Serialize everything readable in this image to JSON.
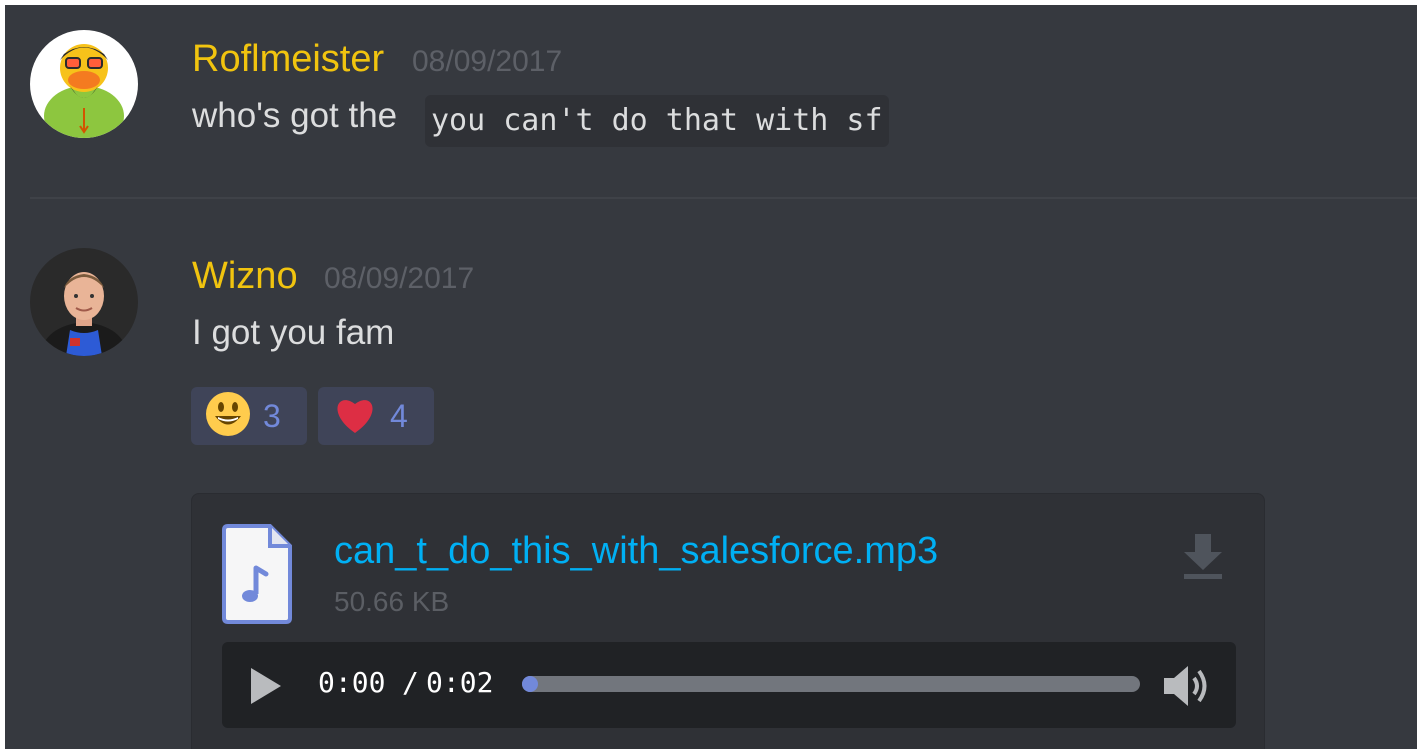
{
  "messages": [
    {
      "username": "Roflmeister",
      "timestamp": "08/09/2017",
      "text": "who's got the",
      "code": "you can't do that with sf",
      "avatar_icon": "rubber-duck-avatar",
      "name_color": "#f1c40f"
    },
    {
      "username": "Wizno",
      "timestamp": "08/09/2017",
      "text": "I got you fam",
      "avatar_icon": "person-photo-avatar",
      "name_color": "#f1c40f",
      "reactions": [
        {
          "emoji": "smiley-face",
          "count": "3"
        },
        {
          "emoji": "red-heart",
          "count": "4"
        }
      ],
      "attachment": {
        "file_name": "can_t_do_this_with_salesforce.mp3",
        "file_size": "50.66 KB",
        "file_icon": "audio-file-icon",
        "download_icon": "download-icon",
        "player": {
          "current_time": "0:00",
          "separator": "/",
          "duration": "0:02",
          "progress": 0.0,
          "play_icon": "play-icon",
          "volume_icon": "volume-icon"
        }
      }
    }
  ],
  "colors": {
    "background": "#36393f",
    "username": "#f1c40f",
    "link": "#00b0f4",
    "accent": "#7289da"
  }
}
